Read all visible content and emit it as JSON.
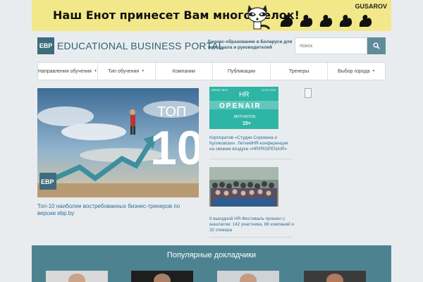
{
  "banner": {
    "text": "Наш Енот принесет Вам много белок!",
    "brand": "GUSAROV"
  },
  "header": {
    "logo_abbr": "EBP",
    "logo_title": "EDUCATIONAL BUSINESS PORTAL",
    "tagline": "Бизнес-образование в Беларуси для персонала и руководителей"
  },
  "search": {
    "placeholder": "поиск"
  },
  "nav": {
    "items": [
      {
        "label": "Направления обучения"
      },
      {
        "label": "Тип обучения"
      },
      {
        "label": "Компании"
      },
      {
        "label": "Публикации"
      },
      {
        "label": "Тренеры"
      },
      {
        "label": "Выбор города"
      }
    ]
  },
  "featured": {
    "image_text": "ТОП",
    "image_number": "10",
    "image_logo": "EBP",
    "caption": "Топ-10 наиболее востребованных бизнес-тренеров по версии ebp.by"
  },
  "news": [
    {
      "img_top_left": "MINSK, BLR",
      "img_top_right": "01.07.2016",
      "img_letters": "HR",
      "img_banner": "OPENAIR",
      "img_sub": "MOTIVATION",
      "img_age": "15+",
      "text": "Корпоратив «Студии Сорокина и Куликовски». ЛетнийHR-конференция на свежем воздухе «HRPROPENAIR»"
    },
    {
      "text": "II выездной HR-Фестиваль прошел с аншлагом: 142 участника, 88 компаний и 32 спикера"
    }
  ],
  "speakers": {
    "title": "Популярные докладчики"
  },
  "colors": {
    "accent": "#4d8391",
    "link": "#2f6f9a",
    "banner": "#f2e889",
    "teal_card": "#2fb5a5"
  }
}
